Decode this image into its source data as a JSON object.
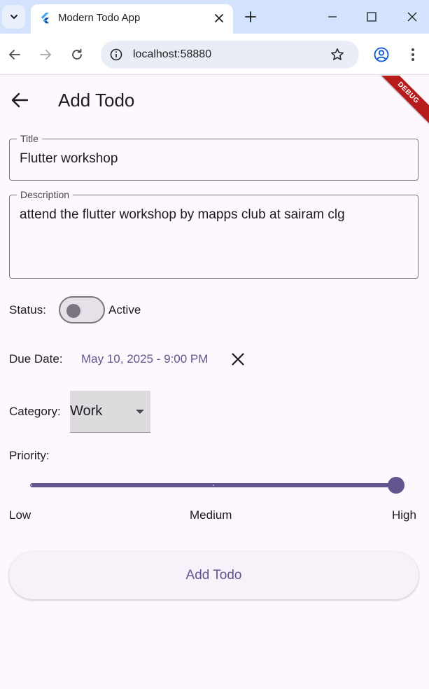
{
  "browser": {
    "tab_title": "Modern Todo App",
    "url": "localhost:58880"
  },
  "app": {
    "debug_banner": "DEBUG",
    "page_title": "Add Todo",
    "title_field": {
      "label": "Title",
      "value": "Flutter workshop"
    },
    "description_field": {
      "label": "Description",
      "value": "attend the flutter workshop by mapps club at sairam clg"
    },
    "status": {
      "label": "Status:",
      "value_text": "Active",
      "on": false
    },
    "due_date": {
      "label": "Due Date:",
      "value": "May 10, 2025 - 9:00 PM"
    },
    "category": {
      "label": "Category:",
      "selected": "Work"
    },
    "priority": {
      "label": "Priority:",
      "levels": [
        "Low",
        "Medium",
        "High"
      ],
      "selected": "High",
      "fraction": 1.0
    },
    "submit_label": "Add Todo"
  },
  "colors": {
    "accent": "#65558f",
    "background": "#fdf7fe",
    "browser_tabbar": "#d3e3fd",
    "debug_ribbon": "#b71c1c"
  },
  "icons": {
    "tab_menu": "chevron-down-icon",
    "favicon": "flutter-icon",
    "tab_close": "close-icon",
    "new_tab": "plus-icon",
    "back": "arrow-left-icon",
    "forward": "arrow-right-icon",
    "reload": "reload-icon",
    "site_info": "info-icon",
    "bookmark": "star-icon",
    "profile": "account-icon",
    "menu": "more-vert-icon",
    "date_clear": "close-icon",
    "dropdown": "caret-down-icon"
  }
}
